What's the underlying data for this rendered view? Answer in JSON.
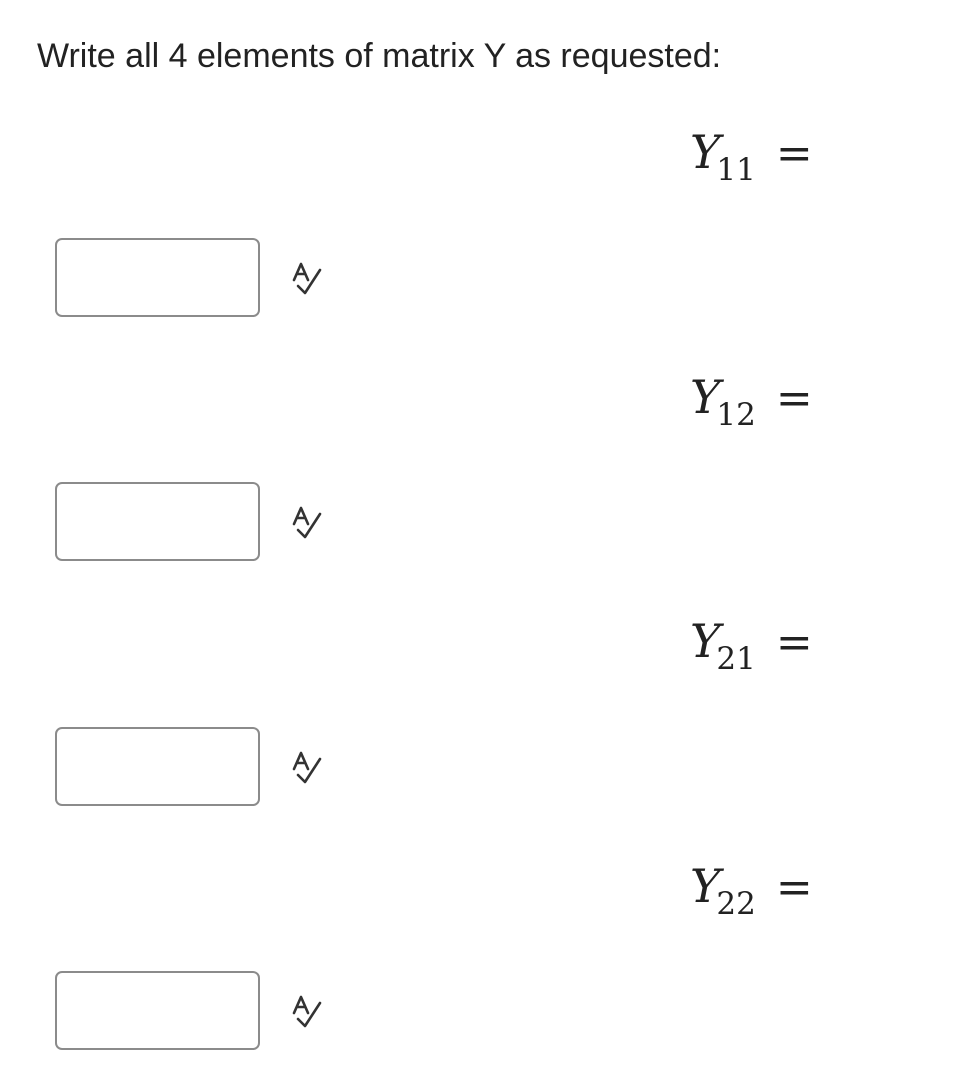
{
  "prompt": "Write all 4 elements of matrix Y as requested:",
  "elements": [
    {
      "var": "Y",
      "sub": "11",
      "equals": "=",
      "value": "",
      "icon": "spell-check-icon"
    },
    {
      "var": "Y",
      "sub": "12",
      "equals": "=",
      "value": "",
      "icon": "spell-check-icon"
    },
    {
      "var": "Y",
      "sub": "21",
      "equals": "=",
      "value": "",
      "icon": "spell-check-icon"
    },
    {
      "var": "Y",
      "sub": "22",
      "equals": "=",
      "value": "",
      "icon": "spell-check-icon"
    }
  ],
  "colors": {
    "text": "#222222",
    "input_border": "#8b8b8b",
    "icon": "#333333"
  }
}
